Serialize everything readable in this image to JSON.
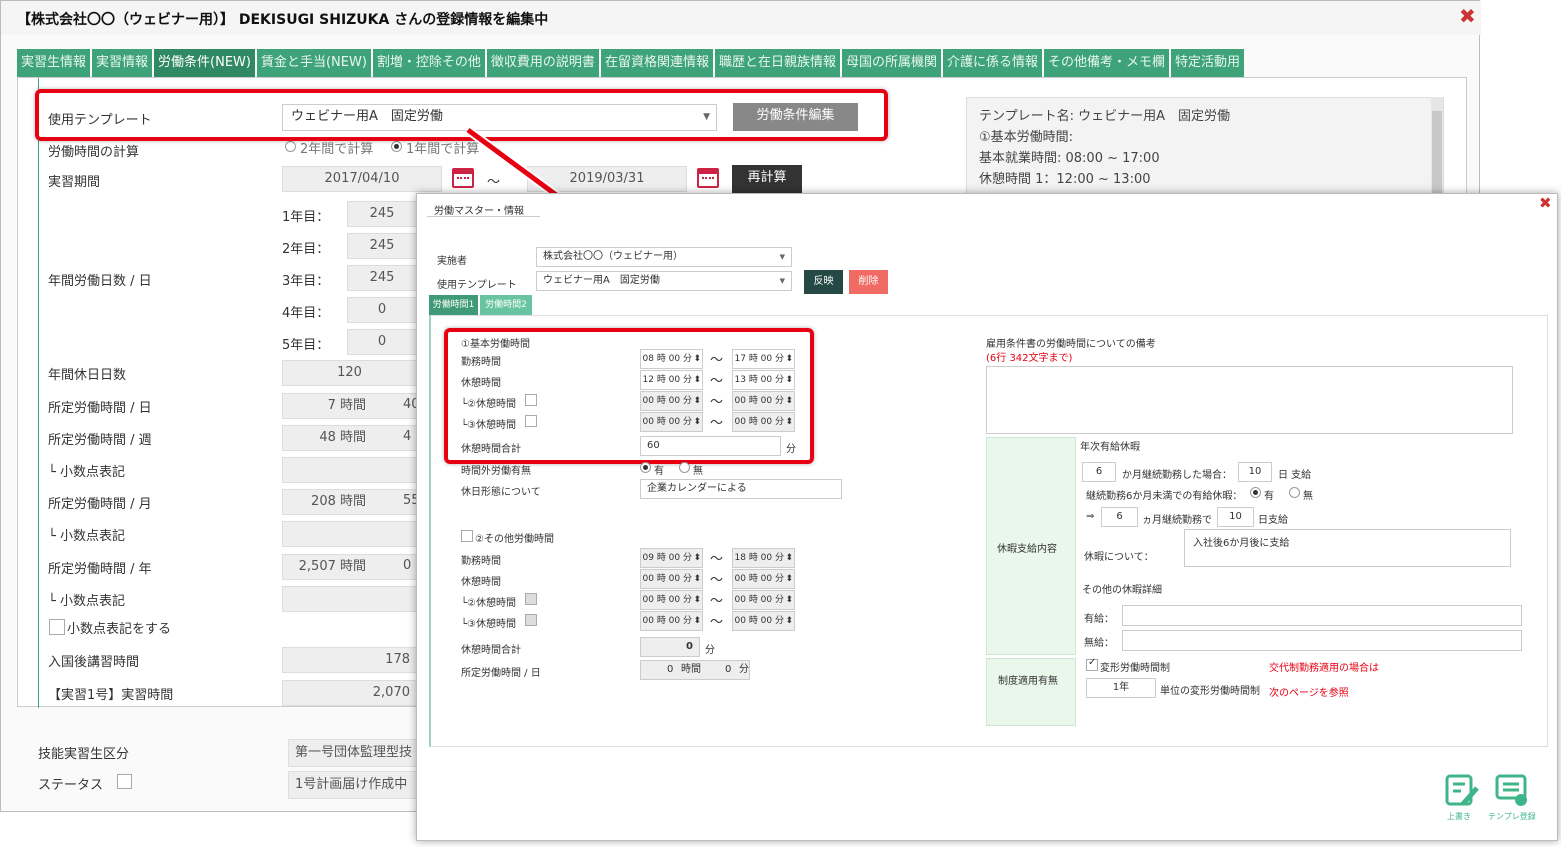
{
  "window": {
    "title": "【株式会社〇〇（ウェビナー用）】 DEKISUGI SHIZUKA さんの登録情報を編集中",
    "close": "✖"
  },
  "tabs": [
    "実習生情報",
    "実習情報",
    "労働条件(NEW)",
    "賃金と手当(NEW)",
    "割増・控除その他",
    "徴収費用の説明書",
    "在留資格関連情報",
    "職歴と在日親族情報",
    "母国の所属機関",
    "介護に係る情報",
    "その他備考・メモ欄",
    "特定活動用"
  ],
  "form": {
    "template_label": "使用テンプレート",
    "template_value": "ウェビナー用A　固定労働",
    "edit_button": "労働条件編集",
    "calc_label": "労働時間の計算",
    "calc_opt1": "2年間で計算",
    "calc_opt2": "1年間で計算",
    "period_label": "実習期間",
    "period_start": "2017/04/10",
    "period_sep": "〜",
    "period_end": "2019/03/31",
    "recalc_button": "再計算",
    "annual_days_label": "年間労働日数 / 日",
    "years": [
      {
        "label": "1年目：",
        "value": "245"
      },
      {
        "label": "2年目：",
        "value": "245"
      },
      {
        "label": "3年目：",
        "value": "245"
      },
      {
        "label": "4年目：",
        "value": "0"
      },
      {
        "label": "5年目：",
        "value": "0"
      }
    ],
    "rows": [
      {
        "label": "年間休日日数",
        "value": "120",
        "extra": ""
      },
      {
        "label": "所定労働時間 / 日",
        "value": "7 時間",
        "extra": "40"
      },
      {
        "label": "所定労働時間 / 週",
        "value": "48 時間",
        "extra": "4"
      },
      {
        "label": "└ 小数点表記",
        "value": "",
        "extra": ""
      },
      {
        "label": "所定労働時間 / 月",
        "value": "208 時間",
        "extra": "55"
      },
      {
        "label": "└ 小数点表記",
        "value": "",
        "extra": ""
      },
      {
        "label": "所定労働時間 / 年",
        "value": "2,507 時間",
        "extra": "0"
      },
      {
        "label": "└ 小数点表記",
        "value": "",
        "extra": ""
      }
    ],
    "decimal_checkbox": "小数点表記をする",
    "post_entry_label": "入国後講習時間",
    "post_entry_value": "178",
    "jisshu1_label": "【実習1号】実習時間",
    "jisshu1_value": "2,070",
    "category_label": "技能実習生区分",
    "category_value": "第一号団体監理型技",
    "status_label": "ステータス",
    "status_value": "1号計画届け作成中"
  },
  "template_info": [
    "テンプレート名: ウェビナー用A　固定労働",
    "①基本労働時間:",
    "基本就業時間: 08:00 ~ 17:00",
    "休憩時間 1：12:00 ~ 13:00"
  ],
  "modal": {
    "title": "労働マスター・情報",
    "close": "✖",
    "org_label": "実施者",
    "org_value": "株式会社〇〇（ウェビナー用）",
    "tmpl_label": "使用テンプレート",
    "tmpl_value": "ウェビナー用A　固定労働",
    "apply_button": "反映",
    "delete_button": "削除",
    "subtabs": [
      "労働時間1",
      "労働時間2"
    ],
    "basic_title": "①基本労働時間",
    "basic_rows": [
      {
        "label": "勤務時間",
        "from": "08 時 00 分",
        "to": "17 時 00 分"
      },
      {
        "label": "休憩時間",
        "from": "12 時 00 分",
        "to": "13 時 00 分"
      },
      {
        "label": "└②休憩時間",
        "from": "00 時 00 分",
        "to": "00 時 00 分"
      },
      {
        "label": "└③休憩時間",
        "from": "00 時 00 分",
        "to": "00 時 00 分"
      }
    ],
    "break_total_label": "休憩時間合計",
    "break_total_value": "60",
    "unit_min": "分",
    "overtime_label": "時間外労働有無",
    "overtime_yes": "有",
    "overtime_no": "無",
    "holiday_label": "休日形態について",
    "holiday_value": "企業カレンダーによる",
    "other_title": "②その他労働時間",
    "other_rows": [
      {
        "label": "勤務時間",
        "from": "09 時 00 分",
        "to": "18 時 00 分"
      },
      {
        "label": "休憩時間",
        "from": "00 時 00 分",
        "to": "00 時 00 分"
      },
      {
        "label": "└②休憩時間",
        "from": "00 時 00 分",
        "to": "00 時 00 分"
      },
      {
        "label": "└③休憩時間",
        "from": "00 時 00 分",
        "to": "00 時 00 分"
      }
    ],
    "other_break_label": "休憩時間合計",
    "other_break_value": "0",
    "other_daily_label": "所定労働時間 / 日",
    "other_daily_hours": "0",
    "other_daily_hours_unit": "時間",
    "other_daily_min": "0",
    "remarks_label": "雇用条件書の労働時間についての備考",
    "remarks_limit": "(6行 342文字まで)",
    "leave_section": "休暇支給内容",
    "annual_leave_title": "年次有給休暇",
    "months": "6",
    "months_text": "か月継続勤務した場合：",
    "days": "10",
    "days_text": "日 支給",
    "under6_text": "継続勤務6か月未満での有給休暇：",
    "under6_yes": "有",
    "under6_no": "無",
    "arrow": "⇒",
    "months2": "6",
    "months2_text": "ヵ月継続勤務で",
    "days2": "10",
    "days2_text": "日支給",
    "about_label": "休暇について：",
    "about_value": "入社後6か月後に支給",
    "other_leave_title": "その他の休暇詳細",
    "paid_label": "有給：",
    "unpaid_label": "無給：",
    "system_label": "制度適用有無",
    "flex_label": "変形労働時間制",
    "flex_note1": "交代制勤務適用の場合は",
    "flex_unit": "1年",
    "flex_unit_text": "単位の変形労働時間制",
    "flex_note2": "次のページを参照",
    "overwrite_label": "上書き",
    "register_label": "テンプレ登録"
  }
}
